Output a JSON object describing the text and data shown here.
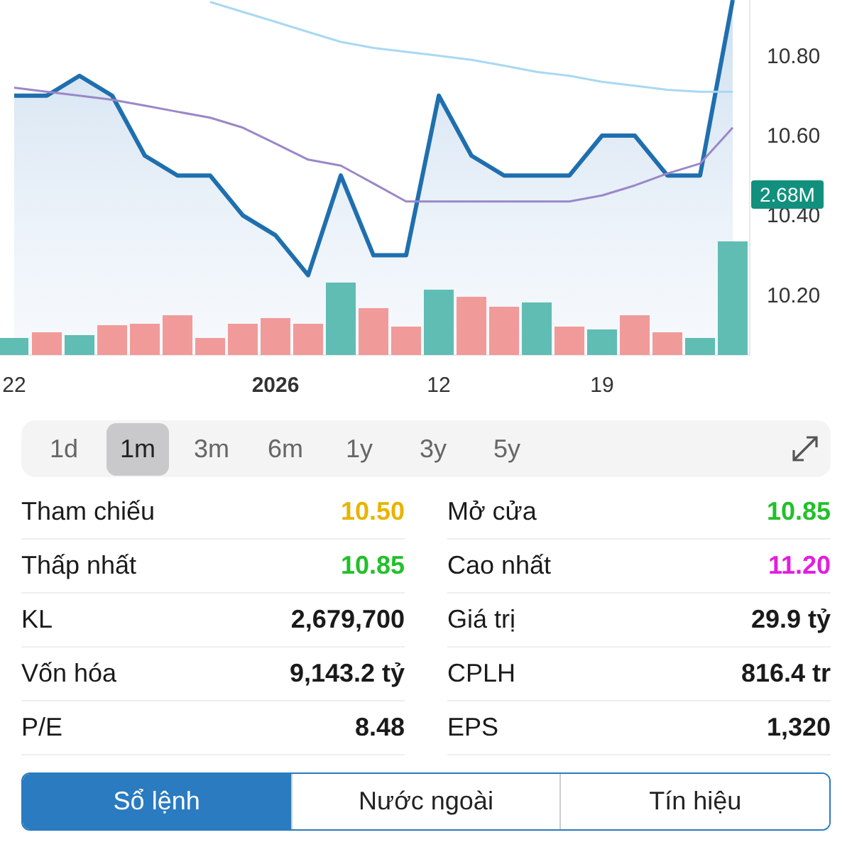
{
  "chart": {
    "volume_badge": "2.68M",
    "chart_data": {
      "type": "line",
      "categories": [
        "22",
        null,
        null,
        null,
        null,
        null,
        null,
        null,
        "2026",
        null,
        null,
        null,
        null,
        "12",
        null,
        null,
        null,
        null,
        "19",
        null,
        null,
        null,
        null
      ],
      "ylim": [
        10.05,
        10.94
      ],
      "yticks": [
        {
          "value": 10.2,
          "label": "10.20"
        },
        {
          "value": 10.4,
          "label": "10.40"
        },
        {
          "value": 10.6,
          "label": "10.60"
        },
        {
          "value": 10.8,
          "label": "10.80"
        }
      ],
      "series": [
        {
          "type": "area",
          "color": "#1f6fae",
          "values": [
            10.7,
            10.7,
            10.75,
            10.7,
            10.55,
            10.5,
            10.5,
            10.4,
            10.35,
            10.25,
            10.5,
            10.3,
            10.3,
            10.7,
            10.55,
            10.5,
            10.5,
            10.5,
            10.6,
            10.6,
            10.5,
            10.5,
            10.94
          ]
        },
        {
          "type": "line",
          "color": "#9b87c9",
          "values": [
            10.72,
            10.71,
            10.7,
            10.69,
            10.675,
            10.66,
            10.645,
            10.62,
            10.58,
            10.54,
            10.525,
            10.48,
            10.435,
            10.435,
            10.435,
            10.435,
            10.435,
            10.435,
            10.45,
            10.475,
            10.505,
            10.53,
            10.62
          ]
        },
        {
          "type": "line",
          "color": "#a9d8f3",
          "values": [
            null,
            null,
            null,
            null,
            null,
            null,
            10.935,
            10.91,
            10.885,
            10.86,
            10.835,
            10.82,
            10.81,
            10.8,
            10.79,
            10.775,
            10.76,
            10.75,
            10.735,
            10.725,
            10.715,
            10.71,
            10.71
          ]
        }
      ]
    }
  },
  "periods": [
    {
      "label": "1d",
      "selected": false
    },
    {
      "label": "1m",
      "selected": true
    },
    {
      "label": "3m",
      "selected": false
    },
    {
      "label": "6m",
      "selected": false
    },
    {
      "label": "1y",
      "selected": false
    },
    {
      "label": "3y",
      "selected": false
    },
    {
      "label": "5y",
      "selected": false
    }
  ],
  "stats": [
    {
      "label": "Tham chiếu",
      "value": "10.50",
      "color": "#e8b400"
    },
    {
      "label": "Mở cửa",
      "value": "10.85",
      "color": "#22c02a"
    },
    {
      "label": "Thấp nhất",
      "value": "10.85",
      "color": "#22c02a"
    },
    {
      "label": "Cao nhất",
      "value": "11.20",
      "color": "#e21ee0"
    },
    {
      "label": "KL",
      "value": "2,679,700",
      "color": "#1a1a1a"
    },
    {
      "label": "Giá trị",
      "value": "29.9 tỷ",
      "color": "#1a1a1a"
    },
    {
      "label": "Vốn hóa",
      "value": "9,143.2 tỷ",
      "color": "#1a1a1a"
    },
    {
      "label": "CPLH",
      "value": "816.4 tr",
      "color": "#1a1a1a"
    },
    {
      "label": "P/E",
      "value": "8.48",
      "color": "#1a1a1a"
    },
    {
      "label": "EPS",
      "value": "1,320",
      "color": "#1a1a1a"
    }
  ],
  "bottom_tabs": [
    {
      "label": "Sổ lệnh",
      "selected": true
    },
    {
      "label": "Nước ngoài",
      "selected": false
    },
    {
      "label": "Tín hiệu",
      "selected": false
    }
  ]
}
